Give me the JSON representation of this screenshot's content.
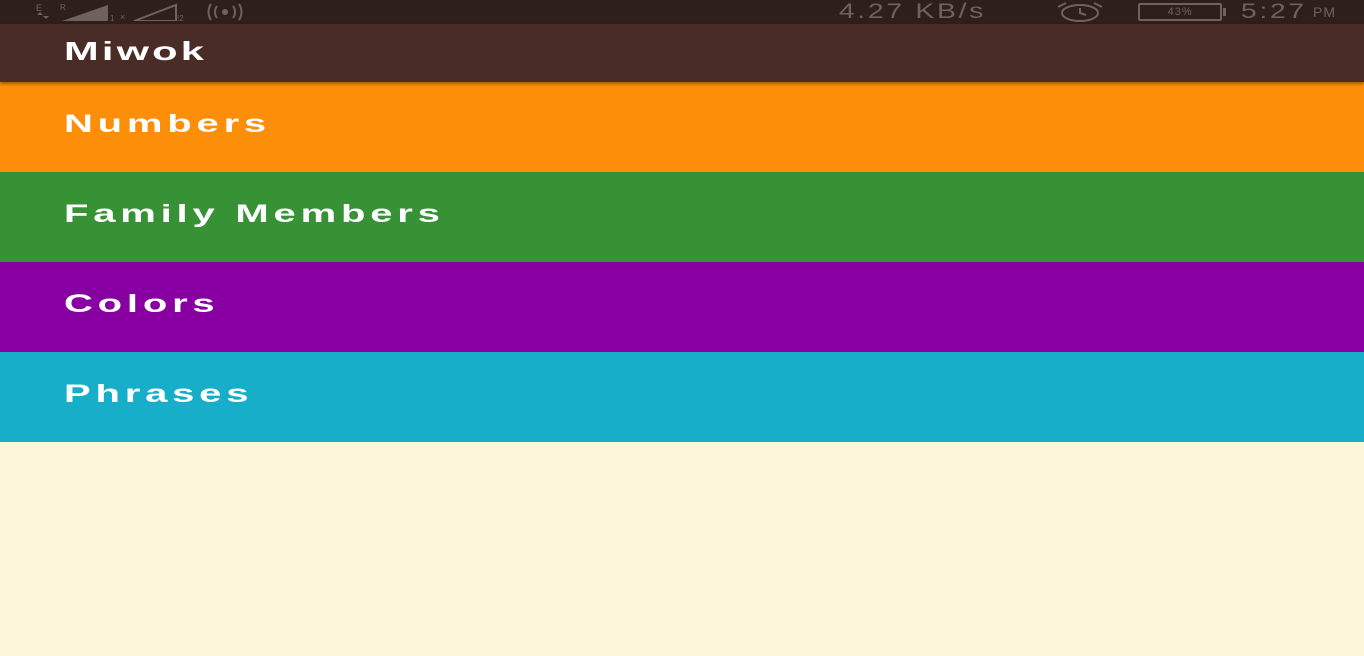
{
  "status_bar": {
    "network_speed": "4.27 KB/s",
    "battery": "43%",
    "time": "5:27",
    "ampm": "PM",
    "icons": [
      "data-arrows-icon",
      "signal-icon",
      "signal-icon",
      "hotspot-icon",
      "alarm-icon",
      "battery-icon"
    ]
  },
  "app_bar": {
    "title": "Miwok",
    "color": "#4a2c27"
  },
  "categories": [
    {
      "label": "Numbers",
      "color": "#fd8e09"
    },
    {
      "label": "Family Members",
      "color": "#379236"
    },
    {
      "label": "Colors",
      "color": "#8800a1"
    },
    {
      "label": "Phrases",
      "color": "#16aec9"
    }
  ],
  "background_color": "#fdf6da"
}
